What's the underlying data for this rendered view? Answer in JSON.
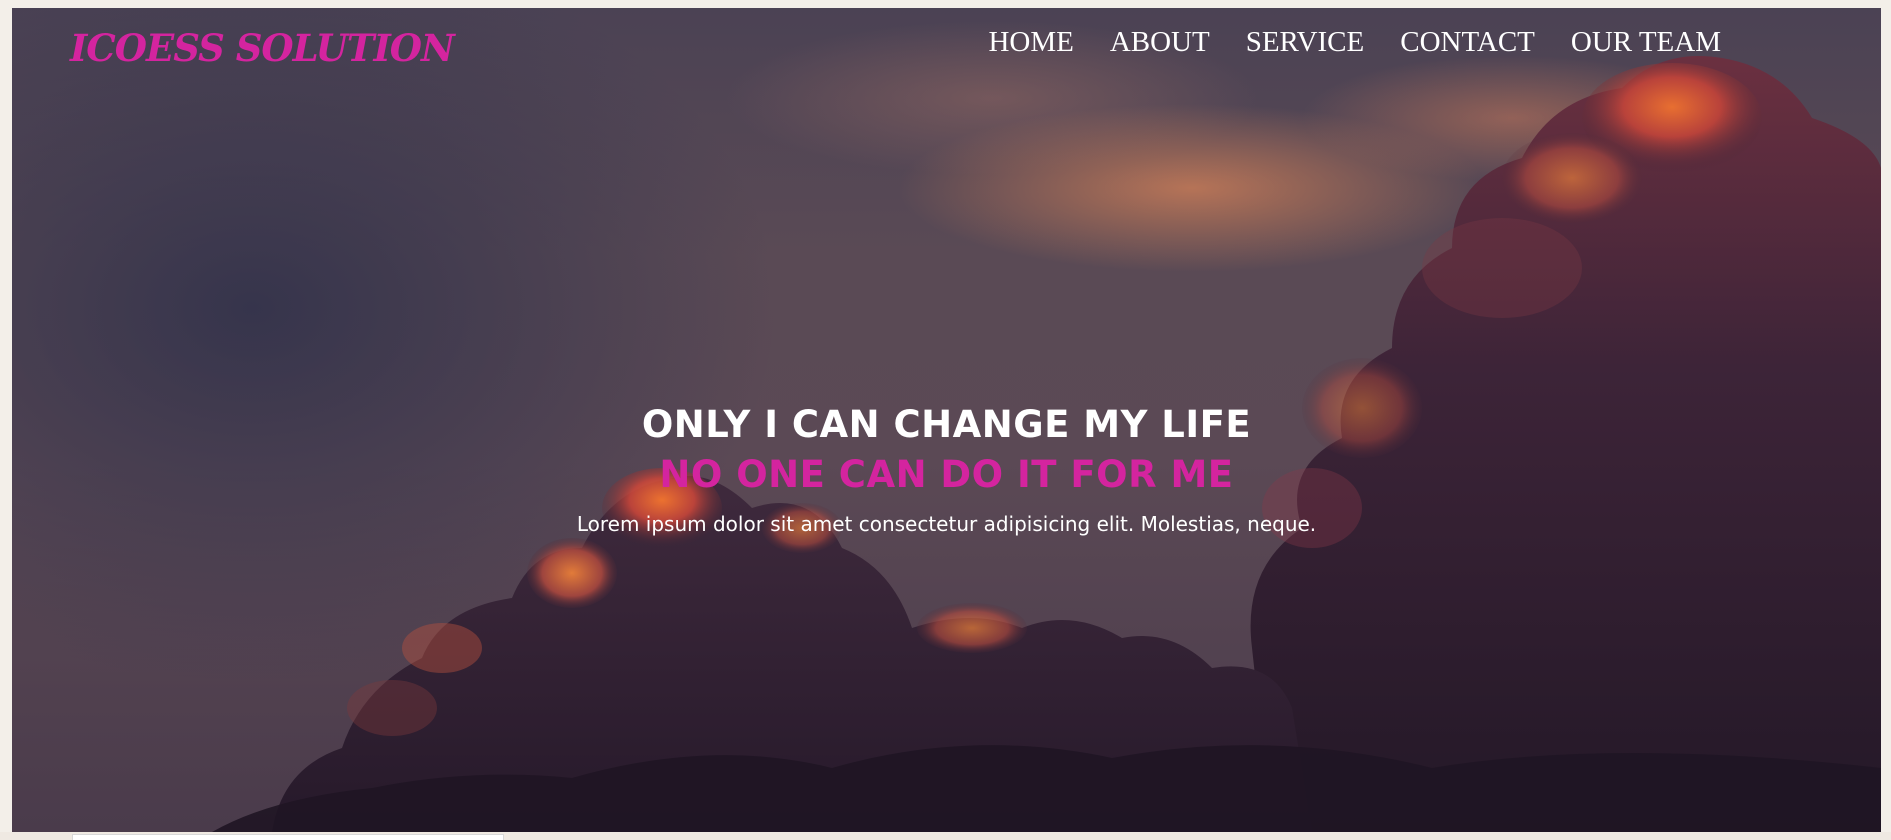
{
  "brand": {
    "logo_text": "ICOESS SOLUTION",
    "accent_color": "#d4249f"
  },
  "nav": {
    "items": [
      {
        "label": "HOME"
      },
      {
        "label": "ABOUT"
      },
      {
        "label": "SERVICE"
      },
      {
        "label": "CONTACT"
      },
      {
        "label": "OUR TEAM"
      }
    ]
  },
  "hero": {
    "headline": "ONLY I CAN CHANGE MY LIFE",
    "subheadline": "NO ONE CAN DO IT FOR ME",
    "text": "Lorem ipsum dolor sit amet consectetur adipisicing elit. Molestias, neque.",
    "background": "sunset-clouds-image"
  }
}
